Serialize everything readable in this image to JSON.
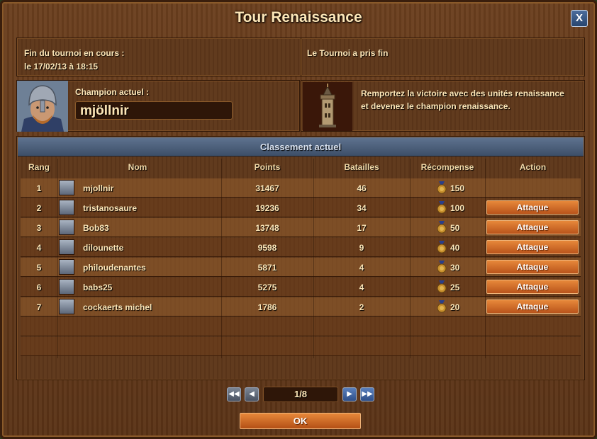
{
  "window": {
    "title": "Tour Renaissance",
    "close_label": "X"
  },
  "tournament": {
    "end_label": "Fin du tournoi en cours :",
    "end_date": "le 17/02/13 à 18:15",
    "status": "Le Tournoi a pris fin"
  },
  "champion": {
    "label": "Champion actuel :",
    "name": "mjöllnir"
  },
  "promo": {
    "text": "Remportez la victoire avec des unités renaissance et devenez le champion renaissance."
  },
  "ranking": {
    "header": "Classement actuel",
    "columns": [
      "Rang",
      "Nom",
      "Points",
      "Batailles",
      "Récompense",
      "Action"
    ],
    "rows": [
      {
        "rank": "1",
        "name": "mjollnir",
        "points": "31467",
        "battles": "46",
        "reward": "150",
        "action": ""
      },
      {
        "rank": "2",
        "name": "tristanosaure",
        "points": "19236",
        "battles": "34",
        "reward": "100",
        "action": "Attaque"
      },
      {
        "rank": "3",
        "name": "Bob83",
        "points": "13748",
        "battles": "17",
        "reward": "50",
        "action": "Attaque"
      },
      {
        "rank": "4",
        "name": "dilounette",
        "points": "9598",
        "battles": "9",
        "reward": "40",
        "action": "Attaque"
      },
      {
        "rank": "5",
        "name": "philoudenantes",
        "points": "5871",
        "battles": "4",
        "reward": "30",
        "action": "Attaque"
      },
      {
        "rank": "6",
        "name": "babs25",
        "points": "5275",
        "battles": "4",
        "reward": "25",
        "action": "Attaque"
      },
      {
        "rank": "7",
        "name": "cockaerts michel",
        "points": "1786",
        "battles": "2",
        "reward": "20",
        "action": "Attaque"
      }
    ]
  },
  "pager": {
    "page": "1/8"
  },
  "footer": {
    "ok_label": "OK"
  },
  "icons": {
    "reward": "medal-icon",
    "first": "double-chevron-left-icon",
    "prev": "chevron-left-icon",
    "next": "chevron-right-icon",
    "last": "double-chevron-right-icon"
  }
}
